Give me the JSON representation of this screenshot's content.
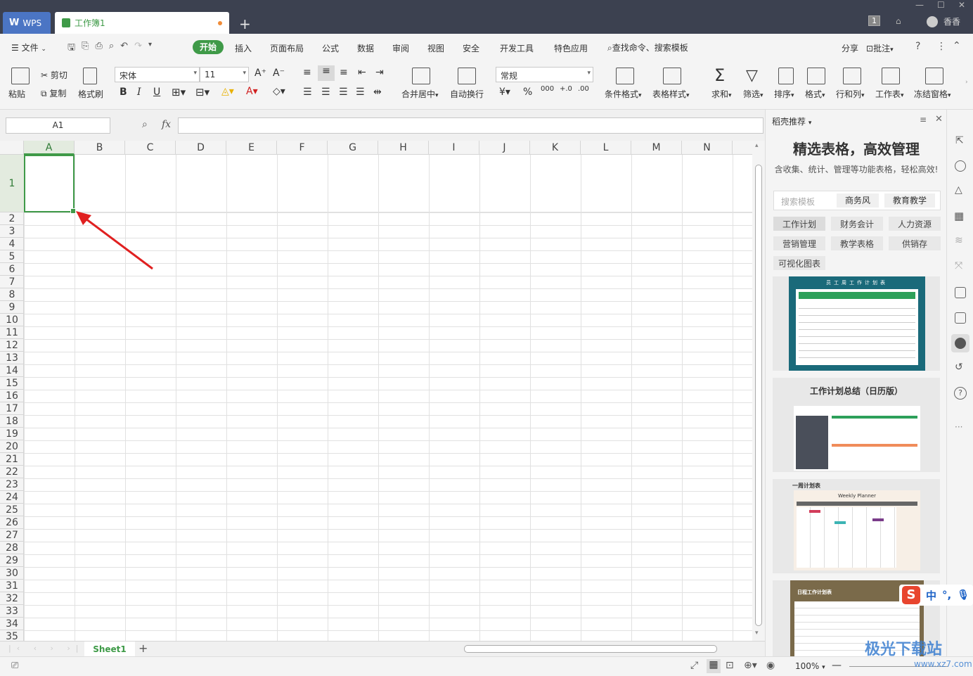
{
  "titlebar": {
    "app_tab": "WPS",
    "doc_tab": "工作簿1",
    "new_tab": "+",
    "page_indicator": "1",
    "user_name": "香香"
  },
  "menubar": {
    "file": "文件",
    "items": [
      "开始",
      "插入",
      "页面布局",
      "公式",
      "数据",
      "审阅",
      "视图",
      "安全",
      "开发工具",
      "特色应用"
    ],
    "search": "查找命令、搜索模板",
    "share": "分享",
    "annotate": "批注"
  },
  "ribbon": {
    "paste": "粘贴",
    "cut": "剪切",
    "copy": "复制",
    "format_painter": "格式刷",
    "font_name": "宋体",
    "font_size": "11",
    "merge_center": "合并居中",
    "wrap_text": "自动换行",
    "number_format": "常规",
    "cond_format": "条件格式",
    "table_style": "表格样式",
    "sum": "求和",
    "filter": "筛选",
    "sort": "排序",
    "format": "格式",
    "rows_cols": "行和列",
    "worksheet": "工作表",
    "freeze": "冻结窗格"
  },
  "formula_bar": {
    "name_box": "A1",
    "fx": "fx"
  },
  "grid": {
    "columns": [
      "A",
      "B",
      "C",
      "D",
      "E",
      "F",
      "G",
      "H",
      "I",
      "J",
      "K",
      "L",
      "M",
      "N"
    ],
    "rows": [
      "1",
      "2",
      "3",
      "4",
      "5",
      "6",
      "7",
      "8",
      "9",
      "10",
      "11",
      "12",
      "13",
      "14",
      "15",
      "16",
      "17",
      "18",
      "19",
      "20",
      "21",
      "22",
      "23",
      "24",
      "25",
      "26",
      "27",
      "28",
      "29",
      "30",
      "31",
      "32",
      "33",
      "34",
      "35"
    ],
    "selected_cell": "A1"
  },
  "sheets": {
    "active": "Sheet1",
    "add": "+"
  },
  "status": {
    "zoom": "100%"
  },
  "panel": {
    "title": "稻壳推荐",
    "headline": "精选表格，高效管理",
    "subtitle": "含收集、统计、管理等功能表格，轻松高效!",
    "search_placeholder": "搜索模板",
    "search_tags": [
      "商务风",
      "教育教学"
    ],
    "categories": [
      "工作计划",
      "财务会计",
      "人力资源",
      "营销管理",
      "教学表格",
      "供销存",
      "可视化图表"
    ],
    "templates": [
      {
        "title": "员工周工作计划表"
      },
      {
        "title": "工作计划总结（日历版）"
      },
      {
        "title": "一周计划表",
        "subtitle": "Weekly Planner"
      },
      {
        "title": "日程工作计划表"
      }
    ]
  },
  "ime": {
    "lang": "中",
    "punct": "°,"
  },
  "watermark": {
    "text": "极光下载站",
    "url": "www.xz7.com"
  },
  "colors": {
    "accent": "#3f9a48",
    "titlebar": "#3c4150",
    "arrow": "#e02020"
  }
}
